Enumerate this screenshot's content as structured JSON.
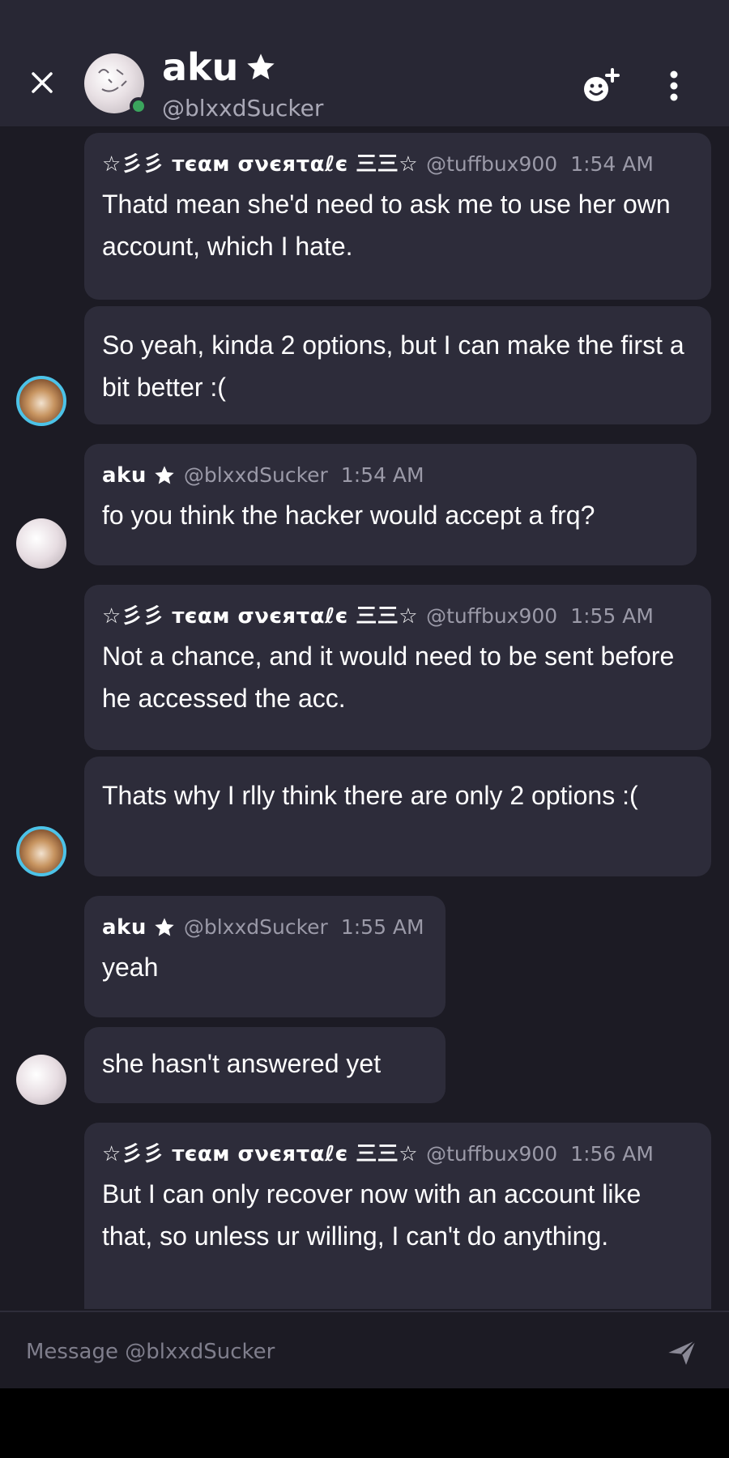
{
  "header": {
    "name": "aku",
    "handle": "@blxxdSucker",
    "icons": {
      "close": "close-icon",
      "add_friend": "add-friend-icon",
      "more": "more-vertical-icon",
      "star": "star-icon"
    }
  },
  "messages": [
    {
      "author": "☆彡彡 тєαм σνєяταℓє 三三☆",
      "handle": "@tuffbux900",
      "time": "1:54 AM",
      "text": "Thatd mean she'd need to ask me to use her own account, which I hate."
    },
    {
      "text": "So yeah, kinda 2 options, but I can make the first a bit better :("
    },
    {
      "author": "aku",
      "handle": "@blxxdSucker",
      "time": "1:54 AM",
      "text": "fo you think the hacker would accept a frq?"
    },
    {
      "author": "☆彡彡 тєαм σνєяταℓє 三三☆",
      "handle": "@tuffbux900",
      "time": "1:55 AM",
      "text": "Not a chance, and it would need to be sent before he accessed the acc."
    },
    {
      "text": "Thats why I rlly think there are only 2 options :("
    },
    {
      "author": "aku",
      "handle": "@blxxdSucker",
      "time": "1:55 AM",
      "text": "yeah"
    },
    {
      "text": "she hasn't answered yet"
    },
    {
      "author": "☆彡彡 тєαм σνєяταℓє 三三☆",
      "handle": "@tuffbux900",
      "time": "1:56 AM",
      "text": "But I can only recover now with an account like that, so unless ur willing, I can't do anything."
    }
  ],
  "composer": {
    "placeholder": "Message @blxxdSucker",
    "send_icon": "send-icon"
  },
  "colors": {
    "background": "#1c1b24",
    "header": "#282734",
    "bubble": "#2d2c3a",
    "online": "#3ba55d",
    "avatar_ring": "#4cc3e8"
  }
}
